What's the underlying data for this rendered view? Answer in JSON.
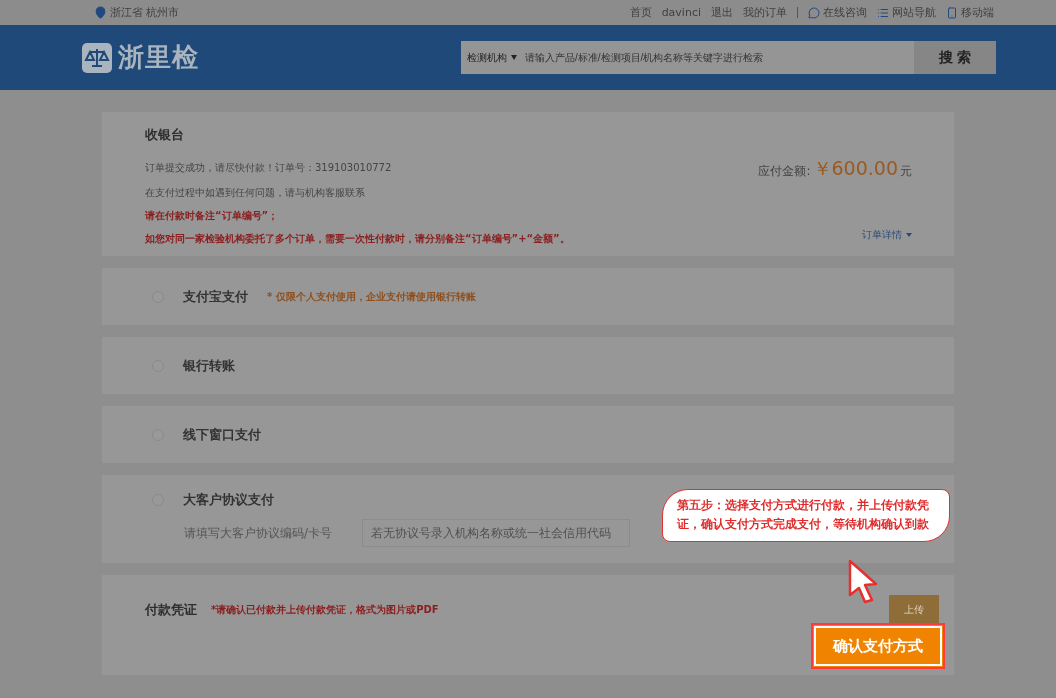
{
  "topbar": {
    "location": "浙江省 杭州市",
    "links": [
      "首页",
      "davinci",
      "退出",
      "我的订单"
    ],
    "tools": [
      {
        "kind": "chat",
        "label": "在线咨询"
      },
      {
        "kind": "list",
        "label": "网站导航"
      },
      {
        "kind": "phone",
        "label": "移动端"
      }
    ]
  },
  "header": {
    "logo": "浙里检",
    "search": {
      "scope": "检测机构",
      "placeholder": "请输入产品/标准/检测项目/机构名称等关键字进行检索",
      "button": "搜 索"
    }
  },
  "checkout": {
    "title": "收银台",
    "lines": [
      {
        "text": "订单提交成功，请尽快付款！订单号：319103010772",
        "kind": "plain"
      },
      {
        "text": "在支付过程中如遇到任何问题，请与机构客服联系",
        "kind": "plain"
      },
      {
        "text": "请在付款时备注“订单编号”；",
        "kind": "warning"
      },
      {
        "text": "如您对同一家检验机构委托了多个订单，需要一次性付款时，请分别备注“订单编号”+“金额”。",
        "kind": "warning"
      }
    ],
    "amount_label": "应付金额:",
    "amount": "￥600.00",
    "unit": "元",
    "details_link": "订单详情"
  },
  "methods": [
    {
      "name": "支付宝支付",
      "note": "* 仅限个人支付使用，企业支付请使用银行转账",
      "selected": false
    },
    {
      "name": "银行转账",
      "selected": false
    },
    {
      "name": "线下窗口支付",
      "selected": false
    },
    {
      "name": "大客户协议支付",
      "selected": false,
      "field_label": "请填写大客户协议编码/卡号",
      "field_placeholder": "若无协议号录入机构名称或统一社会信用代码"
    }
  ],
  "voucher": {
    "title": "付款凭证",
    "note": "*请确认已付款并上传付款凭证，格式为图片或PDF",
    "upload": "上传"
  },
  "tip": "第五步：选择支付方式进行付款，并上传付款凭证，确认支付方式完成支付，等待机构确认到款",
  "confirm": "确认支付方式"
}
